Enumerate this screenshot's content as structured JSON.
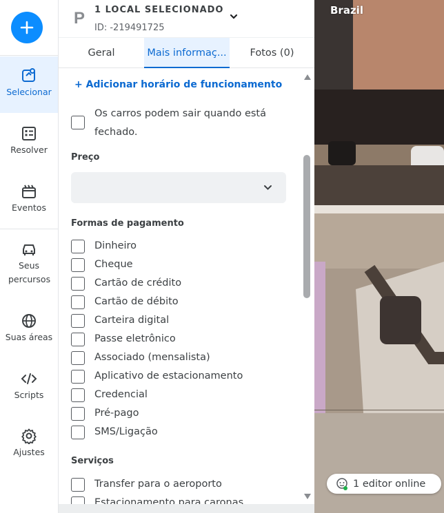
{
  "rail": {
    "items": [
      {
        "label": "Selecionar",
        "icon": "select-icon"
      },
      {
        "label": "Resolver",
        "icon": "resolve-icon"
      },
      {
        "label": "Eventos",
        "icon": "events-icon"
      },
      {
        "label": "Seus percursos",
        "icon": "drives-icon"
      },
      {
        "label": "Suas áreas",
        "icon": "areas-icon"
      },
      {
        "label": "Scripts",
        "icon": "scripts-icon"
      },
      {
        "label": "Ajustes",
        "icon": "settings-icon"
      }
    ],
    "accent": "#0c8dff"
  },
  "header": {
    "category_letter": "P",
    "title": "1 LOCAL SELECIONADO",
    "id_text": "ID: -219491725"
  },
  "tabs": [
    {
      "label": "Geral"
    },
    {
      "label": "Mais informaç..."
    },
    {
      "label": "Fotos (0)"
    }
  ],
  "content": {
    "add_hours": "+ Adicionar horário de funcionamento",
    "closed_exit": "Os carros podem sair quando está fechado.",
    "price_title": "Preço",
    "price_value": "",
    "payment_title": "Formas de pagamento",
    "payment_options": [
      "Dinheiro",
      "Cheque",
      "Cartão de crédito",
      "Cartão de débito",
      "Carteira digital",
      "Passe eletrônico",
      "Associado (mensalista)",
      "Aplicativo de estacionamento",
      "Credencial",
      "Pré-pago",
      "SMS/Ligação"
    ],
    "services_title": "Serviços",
    "services": [
      "Transfer para o aeroporto",
      "Estacionamento para caronas"
    ]
  },
  "map": {
    "country": "Brazil",
    "editors_online": "1 editor online"
  }
}
